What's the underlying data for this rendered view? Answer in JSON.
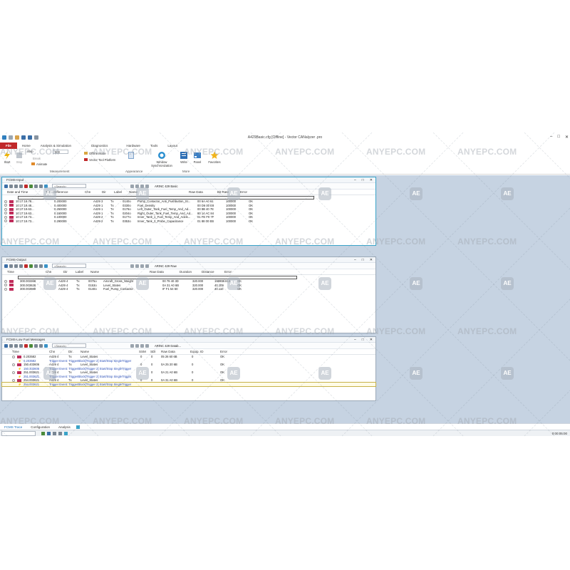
{
  "window": {
    "title": "A429Basic.cfg [Offline] - Vector CANalyzer .pro",
    "controls": [
      "–",
      "□",
      "✕"
    ]
  },
  "ribbon_tabs": [
    "File",
    "Home",
    "Analysis & Simulation",
    "Diagnostics",
    "Hardware",
    "Tools",
    "Layout"
  ],
  "ribbon": {
    "start": "Start",
    "stop": "Stop",
    "step": "Step",
    "step_value": "500",
    "break": "Break",
    "animate": "Animate",
    "offline_mode": "Offline Mode",
    "platform": "Vector Tool Platform",
    "group_measurement": "Measurement",
    "group_appearance": "Appearance",
    "group_more": "More",
    "window_sync": "Window Synchronization",
    "write": "Write",
    "panel": "Panel",
    "favorites": "Favorites"
  },
  "icons": {
    "accent": "#c0282a",
    "active_border": "#3aa3c8",
    "workspace": "#c6d3e2"
  },
  "win1": {
    "title": "FCMS-Input",
    "search_placeholder": "<Search>",
    "preset": "ARINC 429 Basic",
    "headers": [
      "Date and Time",
      "Time Difference",
      "Chn",
      "Dir",
      "Label",
      "Name",
      "Raw Data",
      "Bit Rate",
      "Error"
    ],
    "rows": [
      [
        "10:17:19.78...",
        "0.200000",
        "A429 3",
        "Tx",
        "0140o",
        "Pump_Contactor_Anti_Pushbutton_St...",
        "00 6A A0 61",
        "100000",
        "OK"
      ],
      [
        "10:17:19.48...",
        "0.400000",
        "A429 1",
        "Tx",
        "0330o",
        "Fuel_Density",
        "00 D6 00 E8",
        "100000",
        "OK"
      ],
      [
        "10:17:19.63...",
        "0.250000",
        "A429 1",
        "Tx",
        "0176o",
        "Left_Outer_Tank_Fuel_Temp_And_Ad...",
        "00 9B 40 7E",
        "100000",
        "OK"
      ],
      [
        "10:17:19.63...",
        "0.150000",
        "A429 1",
        "Tx",
        "0204o",
        "Right_Outer_Tank_Fuel_Temp_And_Ad...",
        "80 14 AC 84",
        "100000",
        "OK"
      ],
      [
        "10:17:19.73...",
        "0.100000",
        "A429 2",
        "Tx",
        "0177o",
        "Inner_Tank_1_Fuel_Temp_And_Advis...",
        "01 FE F0 7F",
        "100000",
        "OK"
      ],
      [
        "10:17:19.73...",
        "0.290000",
        "A429 2",
        "Tx",
        "0353o",
        "Inner_Tank_3_Probe_Capacitance",
        "01 88 00 EB",
        "100000",
        "OK"
      ]
    ]
  },
  "win2": {
    "title": "FCMS-Output",
    "search_placeholder": "<Search>",
    "preset": "ARINC 429 Raw",
    "headers": [
      "Time",
      "Chn",
      "Dir",
      "Label",
      "Name",
      "Raw Data",
      "Duration",
      "Distance",
      "Error"
    ],
    "rows": [
      [
        "300.003368",
        "A429 4",
        "Tx",
        "0075o",
        "Aircraft_Gross_Weight",
        "00 79 40 3D",
        "320.000",
        "198999.813",
        "OK"
      ],
      [
        "300.003628",
        "A429 4",
        "Tx",
        "0153o",
        "Level_States",
        "0A 31 A0 6B",
        "320.000",
        "40.109",
        "OK"
      ],
      [
        "300.003989",
        "A429 4",
        "Tx",
        "0140o",
        "Fuel_Pump_Contactor",
        "IF F1 54 60",
        "320.000",
        "40.110",
        "OK"
      ]
    ]
  },
  "win3": {
    "title": "FCMS-Low Fuel Messages",
    "search_placeholder": "<Search>",
    "preset": "ARINC 429 Datab...",
    "headers": [
      "Time",
      "Chn",
      "Dir.",
      "Name",
      "SSM",
      "SDI",
      "Raw Data",
      "Equip. ID",
      "Error"
    ],
    "rows": [
      {
        "kind": "msg",
        "time": "0.203582",
        "chn": "A429 4",
        "dir": "Tx",
        "name": "Level_States",
        "ssm": "0",
        "sdi": "0",
        "raw": "05 26 60 6B",
        "equip": "0",
        "err": "OK"
      },
      {
        "kind": "trigger",
        "time": "0.203582",
        "text": "Trigger Event: TriggerBlock[Trigger 2] Start/Stop SingleTrigger"
      },
      {
        "kind": "msg",
        "time": "150.403606",
        "chn": "A429 4",
        "dir": "Tx",
        "name": "Level_States",
        "ssm": "0",
        "sdi": "0",
        "raw": "0A 25 20 6B",
        "equip": "0",
        "err": "OK"
      },
      {
        "kind": "trigger",
        "time": "150.403606",
        "text": "Trigger Event: TriggerBlock[Trigger 2] Start/Stop SingleTrigger"
      },
      {
        "kind": "msg",
        "time": "251.003621",
        "chn": "A429 4",
        "dir": "Tx",
        "name": "Level_States",
        "ssm": "0",
        "sdi": "0",
        "raw": "0A 21 A0 6B",
        "equip": "0",
        "err": "OK"
      },
      {
        "kind": "trigger",
        "time": "251.003621",
        "text": "Trigger Event: TriggerBlock[Trigger 2] Start/Stop SingleTrigger"
      },
      {
        "kind": "msg",
        "time": "254.003621",
        "chn": "A429 4",
        "dir": "Tx",
        "name": "Level_States",
        "ssm": "0",
        "sdi": "0",
        "raw": "0A 31 A0 6B",
        "equip": "0",
        "err": "OK"
      },
      {
        "kind": "trigger-sel",
        "time": "254.003621",
        "text": "Trigger Event: TriggerBlock[Trigger 2] Start/Stop SingleTrigger"
      }
    ]
  },
  "bottom_tabs": [
    "FCMS Trace",
    "Configuration",
    "Analysis"
  ],
  "status": {
    "clock": "0:00:05:00"
  },
  "watermark": {
    "text": "ANYEPC.COM",
    "logo": "AE"
  }
}
